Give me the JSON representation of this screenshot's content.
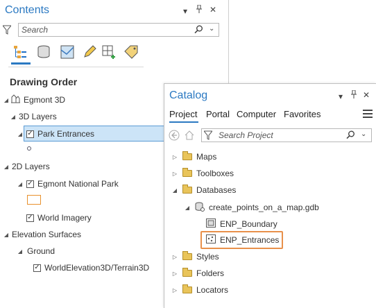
{
  "contents": {
    "title": "Contents",
    "search": {
      "placeholder": "Search"
    },
    "section_title": "Drawing Order",
    "map_name": "Egmont 3D",
    "groups": {
      "layers3d": "3D Layers",
      "park_entrances": "Park Entrances",
      "layers2d": "2D Layers",
      "egmont_np": "Egmont National Park",
      "world_imagery": "World Imagery",
      "elevation": "Elevation Surfaces",
      "ground": "Ground",
      "terrain": "WorldElevation3D/Terrain3D"
    },
    "controls": {
      "menu": "▾",
      "pin": "📌",
      "close": "✕"
    }
  },
  "catalog": {
    "title": "Catalog",
    "tabs": [
      "Project",
      "Portal",
      "Computer",
      "Favorites"
    ],
    "search": {
      "placeholder": "Search Project"
    },
    "items": {
      "maps": "Maps",
      "toolboxes": "Toolboxes",
      "databases": "Databases",
      "gdb": "create_points_on_a_map.gdb",
      "boundary": "ENP_Boundary",
      "entrances": "ENP_Entrances",
      "styles": "Styles",
      "folders": "Folders",
      "locators": "Locators"
    }
  },
  "colors": {
    "accent": "#2b79c2",
    "selected_row": "#cce4f7",
    "selected_border": "#5b9bd5",
    "highlight_box": "#e8904a"
  }
}
